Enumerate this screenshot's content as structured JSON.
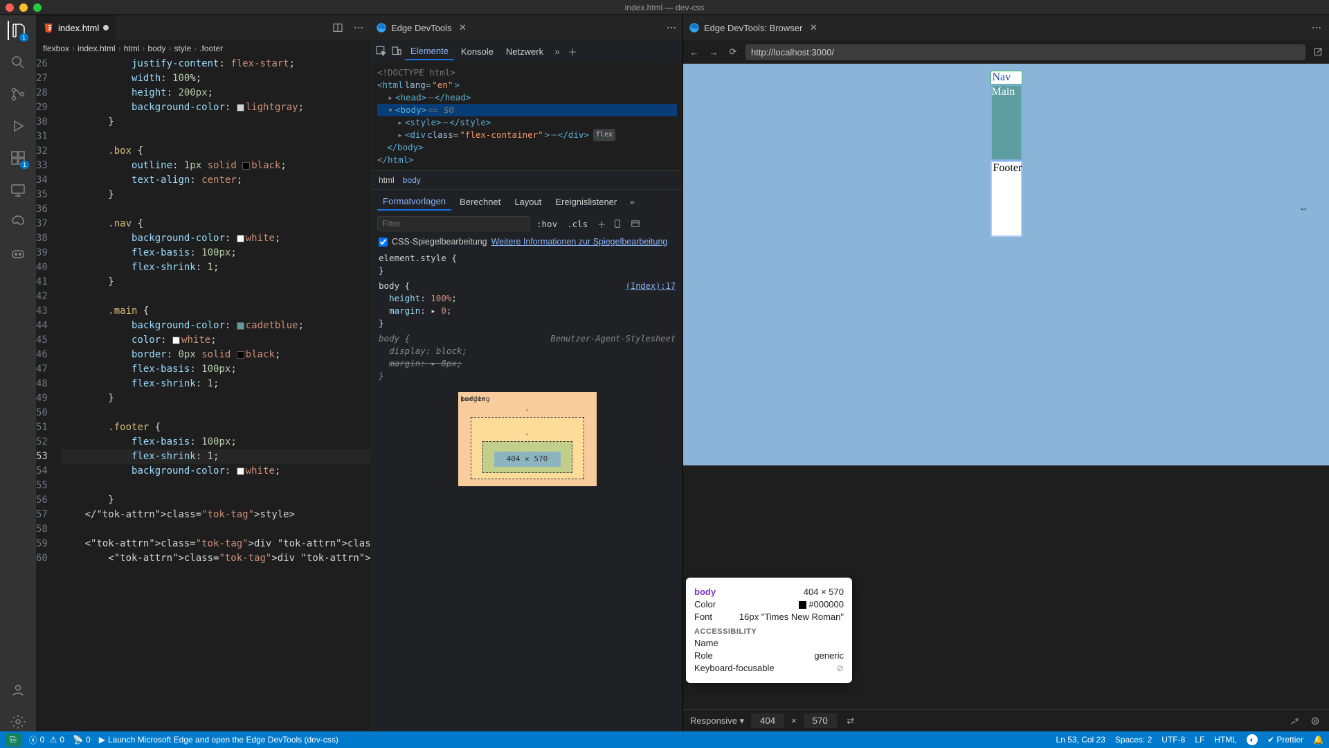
{
  "window": {
    "title": "index.html — dev-css"
  },
  "activitybar": {
    "explorer_badge": "1",
    "extensions_badge": "1"
  },
  "editor": {
    "tab_label": "index.html",
    "breadcrumbs": [
      "flexbox",
      "index.html",
      "html",
      "body",
      "style",
      ".footer"
    ],
    "first_line_no": 26,
    "current_line_no": 53,
    "lines": [
      "            justify-content: flex-start;",
      "            width: 100%;",
      "            height: 200px;",
      "            background-color: ◼lightgray;",
      "        }",
      "",
      "        .box {",
      "            outline: 1px solid ◼black;",
      "            text-align: center;",
      "        }",
      "",
      "        .nav {",
      "            background-color: ◼white;",
      "            flex-basis: 100px;",
      "            flex-shrink: 1;",
      "        }",
      "",
      "        .main {",
      "            background-color: ◼cadetblue;",
      "            color: ◼white;",
      "            border: 0px solid ◼black;",
      "            flex-basis: 100px;",
      "            flex-shrink: 1;",
      "        }",
      "",
      "        .footer {",
      "            flex-basis: 100px;",
      "            flex-shrink: 1;",
      "            background-color: ◼white;",
      "",
      "        }",
      "    </style>",
      "",
      "    <div class=\"flex-container\">",
      "        <div class=\"box nav\" >Nav</div>"
    ]
  },
  "devtools": {
    "tab_label": "Edge DevTools",
    "tools": {
      "elements": "Elemente",
      "console": "Konsole",
      "network": "Netzwerk"
    },
    "dom": {
      "doctype": "<!DOCTYPE html>",
      "html_open": "<html lang=\"en\">",
      "head": "<head> ⋯ </head>",
      "body_open": "<body>",
      "body_hint": "== $0",
      "style": "<style> ⋯ </style>",
      "container_open": "<div class=\"flex-container\"> ⋯ </div>",
      "flex_pill": "flex",
      "body_close": "</body>",
      "html_close": "</html>"
    },
    "crumbs": {
      "html": "html",
      "body": "body"
    },
    "styles_tabs": {
      "styles": "Formatvorlagen",
      "computed": "Berechnet",
      "layout": "Layout",
      "listeners": "Ereignislistener"
    },
    "filter_placeholder": "Filter",
    "toggles": {
      "hov": ":hov",
      "cls": ".cls"
    },
    "mirror_label": "CSS-Spiegelbearbeitung",
    "mirror_link": "Weitere Informationen zur Spiegelbearbeitung",
    "rules": {
      "elstyle": "element.style {",
      "body_sel": "body {",
      "body_src": "(Index):17",
      "height": "height: 100%;",
      "margin0": "margin: ▸ 0;",
      "ua_label": "Benutzer-Agent-Stylesheet",
      "ua_display": "display: block;",
      "ua_margin": "margin: ▸ 8px;"
    },
    "boxmodel": {
      "margin": "margin",
      "border": "border",
      "padding": "padding",
      "content": "404 × 570",
      "dash": "-"
    }
  },
  "preview": {
    "tab_label": "Edge DevTools: Browser",
    "url": "http://localhost:3000/",
    "boxes": {
      "nav": "Nav",
      "main": "Main",
      "footer": "Footer"
    },
    "card": {
      "title": "body",
      "dims": "404 × 570",
      "color_label": "Color",
      "color_val": "#000000",
      "font_label": "Font",
      "font_val": "16px \"Times New Roman\"",
      "acc_label": "ACCESSIBILITY",
      "name_label": "Name",
      "role_label": "Role",
      "role_val": "generic",
      "kf_label": "Keyboard-focusable"
    },
    "footer": {
      "mode": "Responsive",
      "w": "404",
      "h": "570"
    }
  },
  "statusbar": {
    "remote_tip": "⎇",
    "errors": "0",
    "warnings": "0",
    "ports": "0",
    "launch": "Launch Microsoft Edge and open the Edge DevTools (dev-css)",
    "lncol": "Ln 53, Col 23",
    "spaces": "Spaces: 2",
    "encoding": "UTF-8",
    "eol": "LF",
    "lang": "HTML",
    "prettier": "Prettier"
  }
}
